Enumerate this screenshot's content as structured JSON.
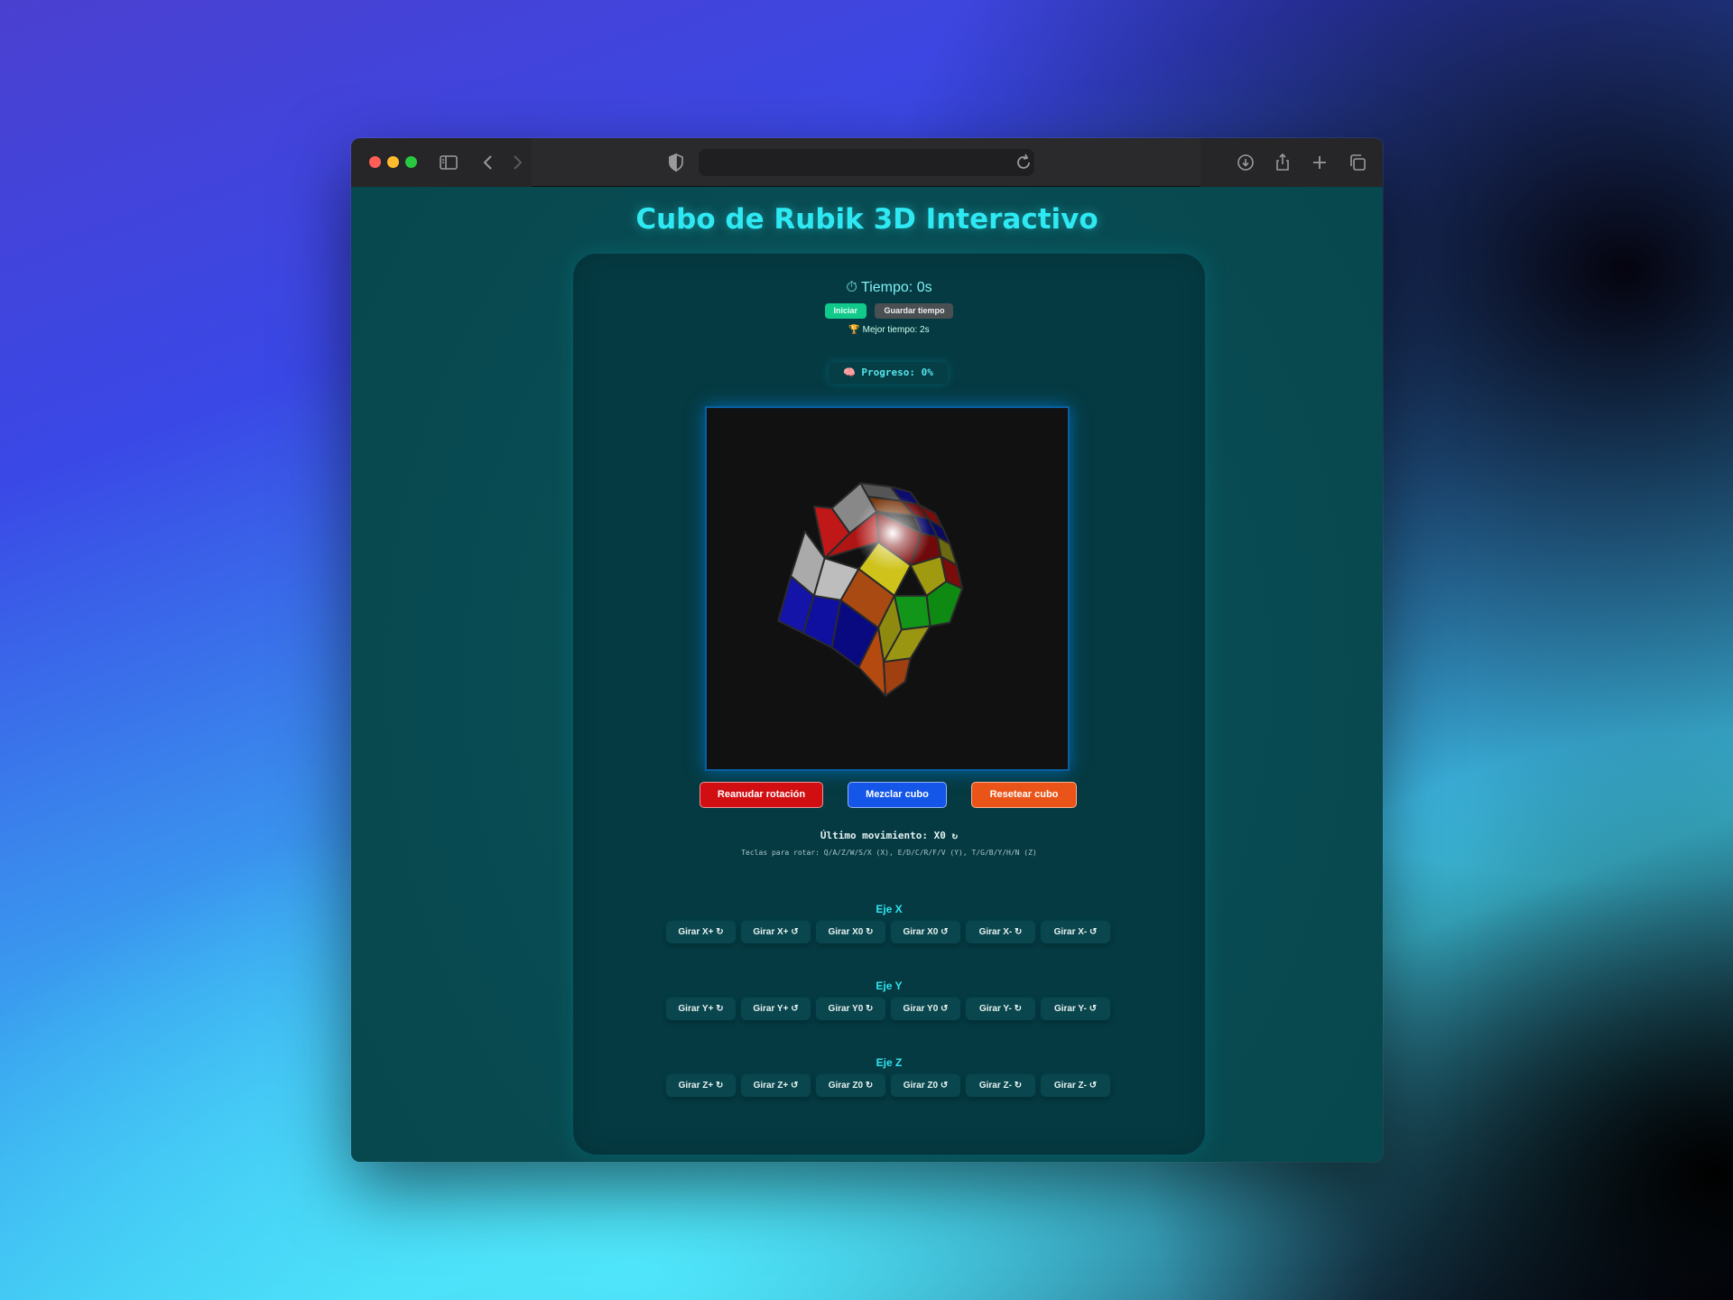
{
  "page": {
    "title": "Cubo de Rubik 3D Interactivo"
  },
  "timer": {
    "label": "⏱ Tiempo: 0s",
    "start_button": "Iniciar",
    "save_button": "Guardar tiempo",
    "best": "🏆 Mejor tiempo: 2s"
  },
  "progress": {
    "label": "🧠 Progreso: 0%",
    "value": 0
  },
  "actions": {
    "resume": "Reanudar rotación",
    "shuffle": "Mezclar cubo",
    "reset": "Resetear cubo"
  },
  "status": {
    "last_move": "Último movimiento: X0 ↻",
    "keys_hint": "Teclas para rotar: Q/A/Z/W/S/X (X), E/D/C/R/F/V (Y), T/G/B/Y/H/N (Z)"
  },
  "axes": [
    {
      "title": "Eje X",
      "buttons": [
        "Girar X+ ↻",
        "Girar X+ ↺",
        "Girar X0 ↻",
        "Girar X0 ↺",
        "Girar X- ↻",
        "Girar X- ↺"
      ]
    },
    {
      "title": "Eje Y",
      "buttons": [
        "Girar Y+ ↻",
        "Girar Y+ ↺",
        "Girar Y0 ↻",
        "Girar Y0 ↺",
        "Girar Y- ↻",
        "Girar Y- ↺"
      ]
    },
    {
      "title": "Eje Z",
      "buttons": [
        "Girar Z+ ↻",
        "Girar Z+ ↺",
        "Girar Z0 ↻",
        "Girar Z0 ↺",
        "Girar Z- ↻",
        "Girar Z- ↺"
      ]
    }
  ],
  "colors": {
    "title": "#2ee8f2",
    "background": "#07474e",
    "resume_button": "#d10e12",
    "shuffle_button": "#1456e8",
    "reset_button": "#ea5418",
    "start_button": "#11c98a"
  },
  "browser": {
    "icons": [
      "sidebar-icon",
      "back-icon",
      "forward-icon",
      "shield-icon",
      "reload-icon",
      "download-icon",
      "share-icon",
      "new-tab-icon",
      "tabs-overview-icon"
    ]
  }
}
